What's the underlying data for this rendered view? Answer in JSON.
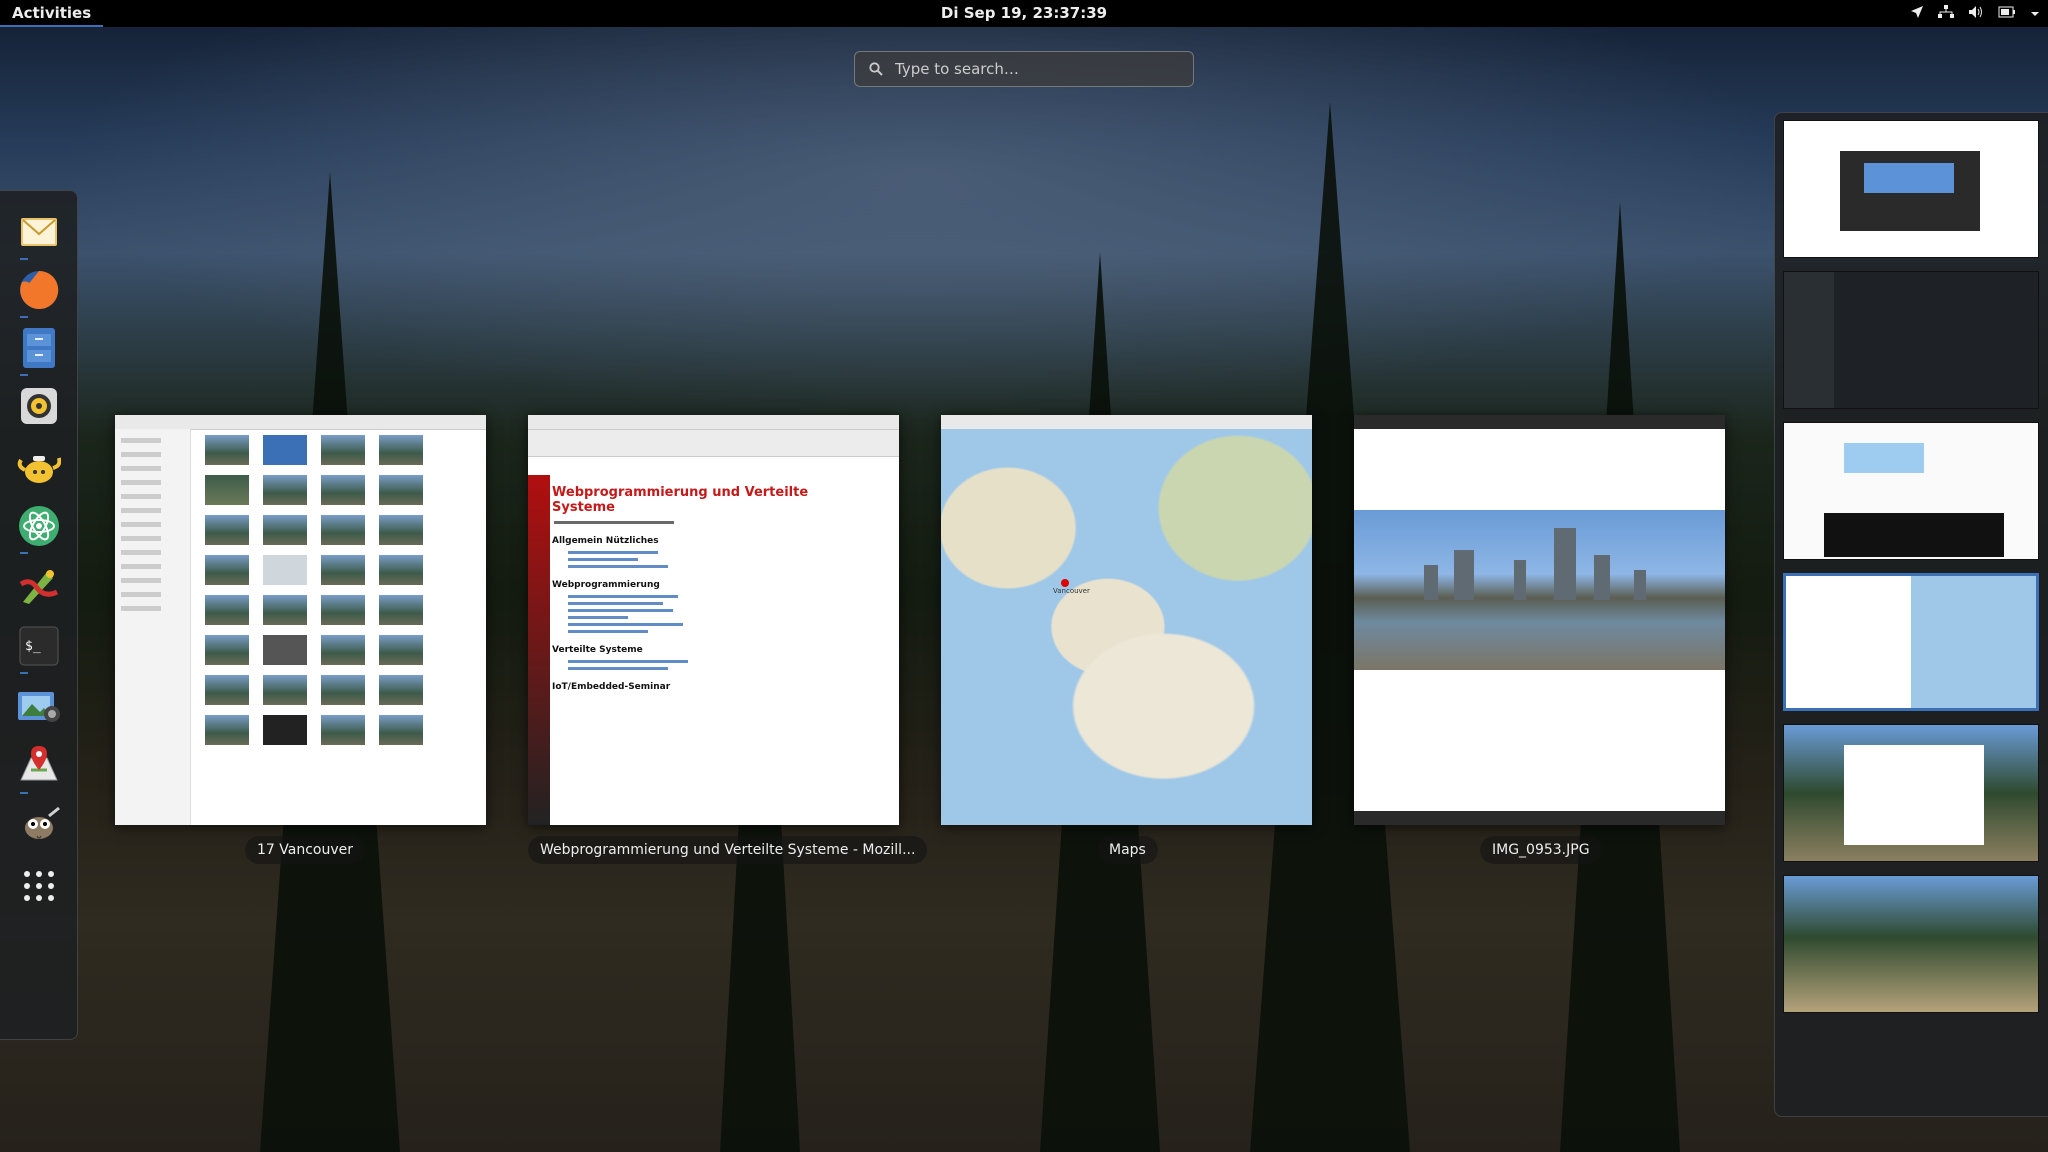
{
  "topbar": {
    "activities_label": "Activities",
    "clock": "Di Sep 19, 23:37:39",
    "tray_icons": [
      "location-icon",
      "network-icon",
      "volume-icon",
      "battery-icon",
      "system-menu-chevron-icon"
    ]
  },
  "search": {
    "placeholder": "Type to search…"
  },
  "dash": {
    "apps": [
      {
        "name": "mail",
        "running": true
      },
      {
        "name": "firefox",
        "running": true
      },
      {
        "name": "files",
        "running": true
      },
      {
        "name": "rhythmbox",
        "running": false
      },
      {
        "name": "teapot",
        "running": false
      },
      {
        "name": "atom",
        "running": true
      },
      {
        "name": "inkscape",
        "running": false
      },
      {
        "name": "terminal",
        "running": true
      },
      {
        "name": "photos",
        "running": false
      },
      {
        "name": "maps",
        "running": true
      },
      {
        "name": "gimp",
        "running": false
      },
      {
        "name": "show-apps",
        "running": false
      }
    ]
  },
  "windows": [
    {
      "label": "17 Vancouver",
      "kind": "file-manager"
    },
    {
      "label": "Webprogrammierung und Verteilte Systeme - Mozill...",
      "kind": "firefox",
      "doc_title": "Webprogrammierung und Verteilte Systeme",
      "sections": [
        "Allgemein Nützliches",
        "Webprogrammierung",
        "Verteilte Systeme",
        "IoT/Embedded-Seminar"
      ]
    },
    {
      "label": "Maps",
      "kind": "maps",
      "place": "Vancouver"
    },
    {
      "label": "IMG_0953.JPG",
      "kind": "image-viewer"
    }
  ],
  "workspaces": {
    "count": 6,
    "active_index": 3
  },
  "colors": {
    "accent": "#3b6fb6",
    "topbar": "#000000",
    "doc_heading": "#c41a1a"
  }
}
